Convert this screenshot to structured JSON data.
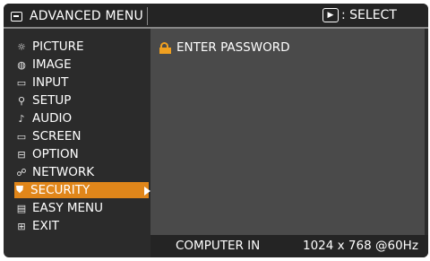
{
  "header": {
    "title": "ADVANCED MENU",
    "title_icon": "menu-icon",
    "select_hint": ": SELECT",
    "select_icon": "enter-icon"
  },
  "menu": {
    "items": [
      {
        "label": "PICTURE",
        "icon": "sun-icon",
        "glyph": "☼"
      },
      {
        "label": "IMAGE",
        "icon": "image-icon",
        "glyph": "◍"
      },
      {
        "label": "INPUT",
        "icon": "input-icon",
        "glyph": "▭"
      },
      {
        "label": "SETUP",
        "icon": "setup-icon",
        "glyph": "⚲"
      },
      {
        "label": "AUDIO",
        "icon": "note-icon",
        "glyph": "♪"
      },
      {
        "label": "SCREEN",
        "icon": "screen-icon",
        "glyph": "▭"
      },
      {
        "label": "OPTION",
        "icon": "option-icon",
        "glyph": "⊟"
      },
      {
        "label": "NETWORK",
        "icon": "network-icon",
        "glyph": "☍"
      },
      {
        "label": "SECURITY",
        "icon": "shield-icon",
        "glyph": "⛊"
      },
      {
        "label": "EASY MENU",
        "icon": "easy-menu-icon",
        "glyph": "▤"
      },
      {
        "label": "EXIT",
        "icon": "exit-icon",
        "glyph": "⊞"
      }
    ],
    "selected_index": 8
  },
  "panel": {
    "items": [
      {
        "label": "ENTER PASSWORD",
        "icon": "key-icon"
      }
    ]
  },
  "status": {
    "source": "COMPUTER IN",
    "resolution": "1024 x 768 @60Hz"
  },
  "colors": {
    "highlight": "#e0861a",
    "background": "#2b2b2b",
    "panel": "#4a4a4a"
  }
}
